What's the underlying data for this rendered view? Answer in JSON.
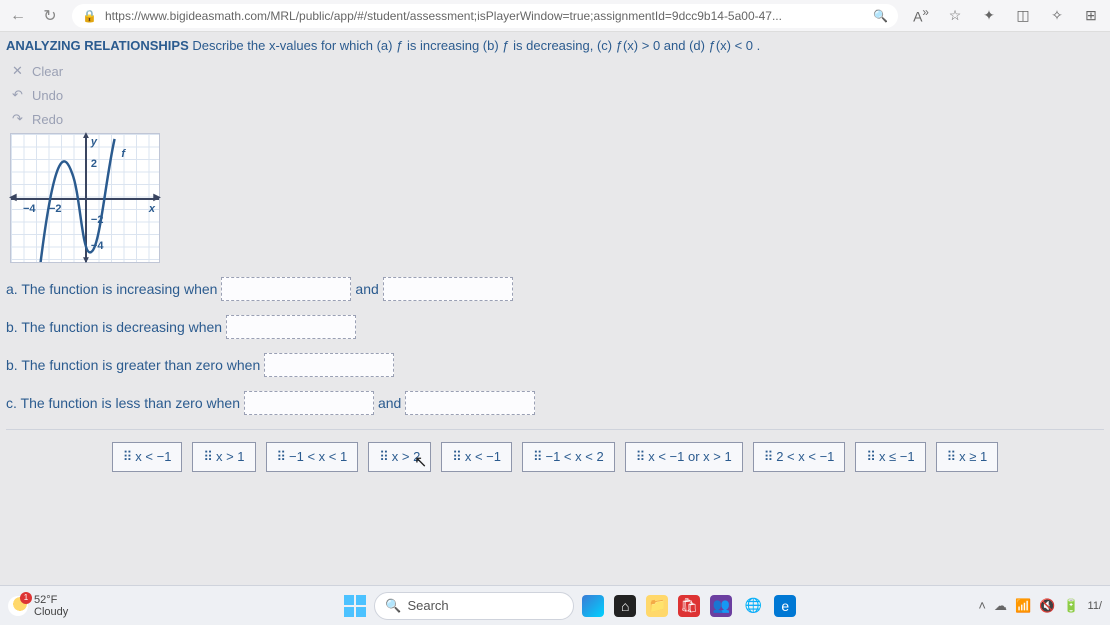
{
  "browser": {
    "url": "https://www.bigideasmath.com/MRL/public/app/#/student/assessment;isPlayerWindow=true;assignmentId=9dcc9b14-5a00-47..."
  },
  "heading": {
    "bold": "ANALYZING RELATIONSHIPS",
    "rest": " Describe the x-values for which (a) ƒ is increasing (b) ƒ is decreasing, (c) ƒ(x) > 0 and (d) ƒ(x) < 0 ."
  },
  "tools": {
    "clear": "Clear",
    "undo": "Undo",
    "redo": "Redo"
  },
  "graph": {
    "ticks": {
      "xneg4": "−4",
      "xneg2": "−2",
      "y2": "2",
      "yneg2": "−2",
      "yneg4": "−4"
    },
    "labels": {
      "x": "x",
      "y": "y",
      "f": "f"
    }
  },
  "questions": {
    "a_pre": "a. The function is increasing when",
    "a_mid": "and",
    "b_pre": "b. The function is decreasing when",
    "c_pre": "b. The function is greater than zero when",
    "d_pre": "c. The function is less than zero when",
    "d_mid": "and"
  },
  "tiles": [
    "x < −1",
    "x > 1",
    "−1 < x < 1",
    "x > 2",
    "x < −1",
    "−1 < x < 2",
    "x < −1 or x > 1",
    "2 < x < −1",
    "x ≤ −1",
    "x ≥ 1"
  ],
  "taskbar": {
    "temp": "52°F",
    "cond": "Cloudy",
    "search": "Search",
    "time": "11/"
  }
}
